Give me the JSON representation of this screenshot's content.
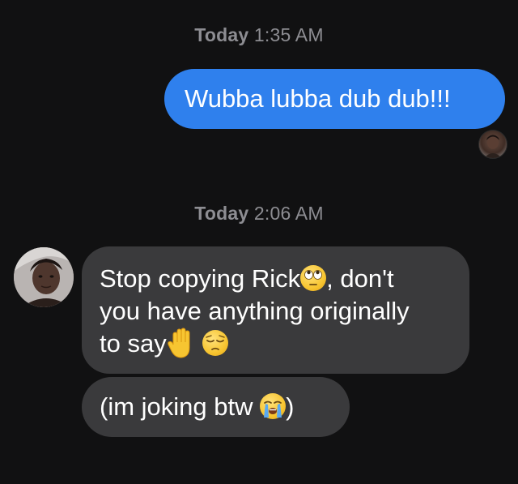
{
  "timestamps": [
    {
      "day": "Today",
      "time": "1:35 AM"
    },
    {
      "day": "Today",
      "time": "2:06 AM"
    }
  ],
  "messages": {
    "outgoing": {
      "text": "Wubba lubba dub dub!!!"
    },
    "incoming_1": {
      "line1_a": "Stop copying Rick",
      "line1_emoji": "face-with-rolling-eyes-icon",
      "line1_b": ", don't",
      "line2": "you have anything originally",
      "line3_a": "to say",
      "line3_emoji1": "raised-hand-icon",
      "line3_emoji2": "pensive-face-icon"
    },
    "incoming_2": {
      "text_a": "(im joking btw ",
      "emoji": "loudly-crying-face-icon",
      "text_b": ")"
    }
  },
  "colors": {
    "background": "#111112",
    "outgoing_bubble": "#2f80ed",
    "incoming_bubble": "#3a3a3c",
    "timestamp_text": "#8d8d92",
    "message_text": "#ffffff"
  }
}
